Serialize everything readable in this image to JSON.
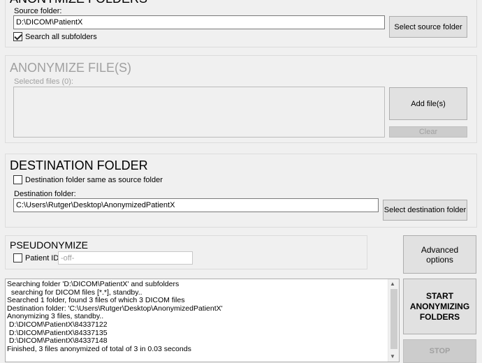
{
  "anonymize_folders": {
    "title": "ANONYMIZE FOLDERS",
    "source_label": "Source folder:",
    "source_value": "D:\\DICOM\\PatientX",
    "search_subfolders_label": "Search all subfolders",
    "search_subfolders_checked": true,
    "select_source_button": "Select source folder"
  },
  "anonymize_files": {
    "title": "ANONYMIZE FILE(S)",
    "selected_label": "Selected files (0):",
    "add_files_button": "Add file(s)",
    "clear_button": "Clear"
  },
  "destination": {
    "title": "DESTINATION FOLDER",
    "same_as_source_label": "Destination folder same as source folder",
    "same_as_source_checked": false,
    "destination_label": "Destination folder:",
    "destination_value": "C:\\Users\\Rutger\\Desktop\\AnonymizedPatientX",
    "select_destination_button": "Select destination folder"
  },
  "pseudonymize": {
    "title": "PSEUDONYMIZE",
    "patient_id_label": "Patient ID",
    "patient_id_checked": false,
    "patient_id_placeholder": "-off-"
  },
  "advanced_button": "Advanced options",
  "start_button": "START ANONYMIZING FOLDERS",
  "stop_button": "STOP",
  "log_lines": [
    "Searching folder 'D:\\DICOM\\PatientX' and subfolders",
    "  searching for DICOM files [*.*], standby..",
    "Searched 1 folder, found 3 files of which 3 DICOM files",
    "Destination folder: 'C:\\Users\\Rutger\\Desktop\\AnonymizedPatientX'",
    "Anonymizing 3 files, standby..",
    " D:\\DICOM\\PatientX\\84337122",
    " D:\\DICOM\\PatientX\\84337135",
    " D:\\DICOM\\PatientX\\84337148",
    "Finished, 3 files anonymized of total of 3 in 0.03 seconds"
  ]
}
